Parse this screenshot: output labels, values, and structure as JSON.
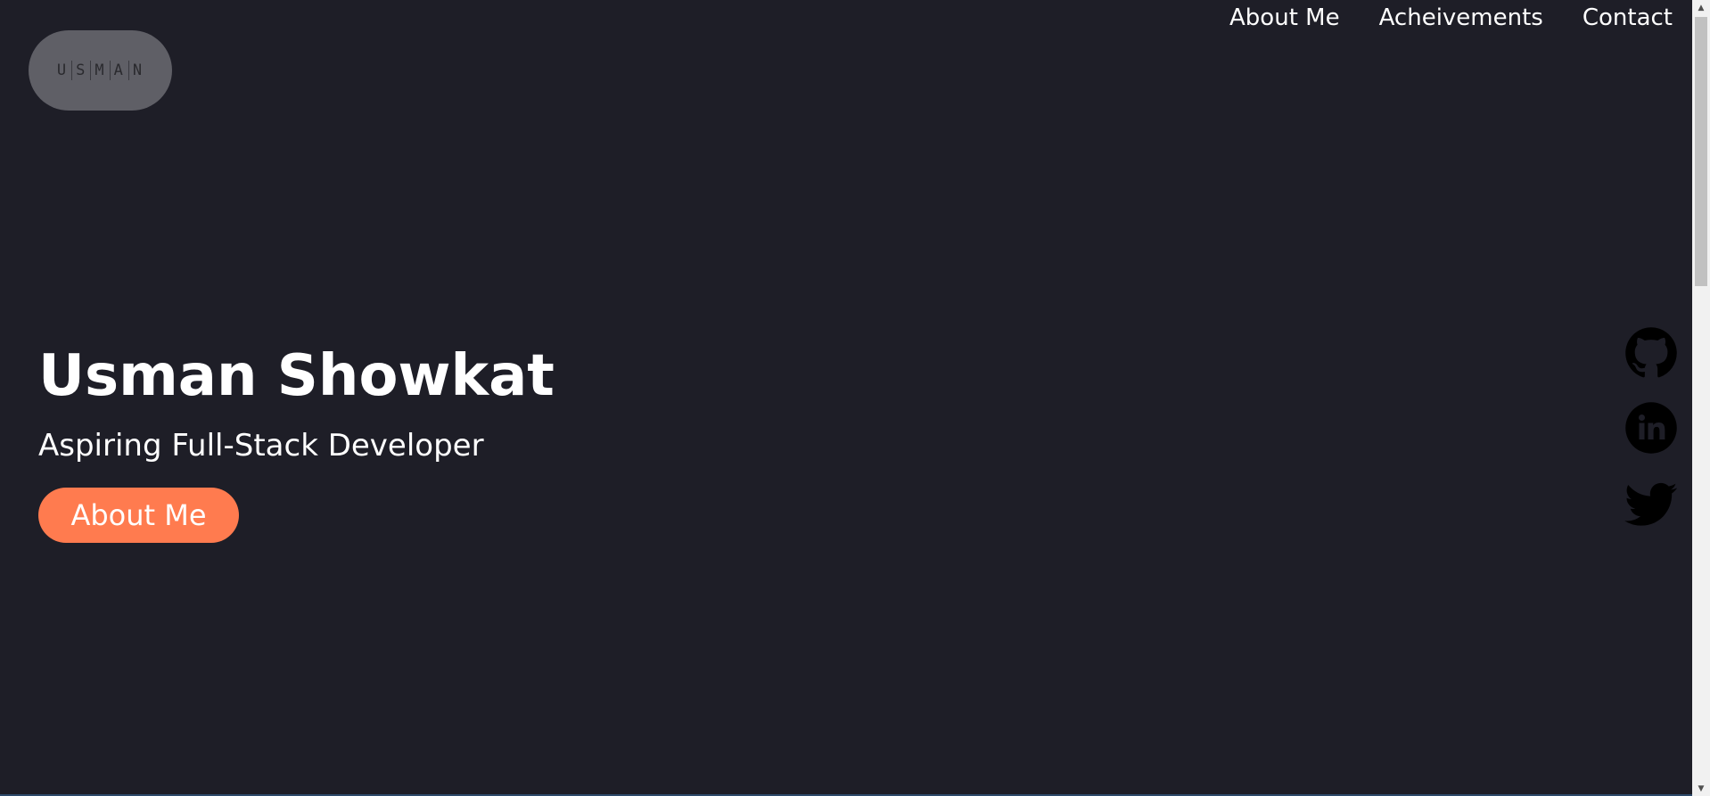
{
  "logo": {
    "letters": [
      "U",
      "S",
      "M",
      "A",
      "N"
    ],
    "background": "#5f5f66"
  },
  "nav": {
    "items": [
      {
        "label": "About Me"
      },
      {
        "label": "Acheivements"
      },
      {
        "label": "Contact"
      }
    ]
  },
  "hero": {
    "name": "Usman Showkat",
    "tagline": "Aspiring Full-Stack Developer",
    "button_label": "About Me",
    "button_color": "#ff7b4f"
  },
  "social": {
    "icons": [
      "github-icon",
      "linkedin-icon",
      "twitter-icon"
    ]
  },
  "theme": {
    "background": "#1e1e27",
    "text": "#ffffff"
  }
}
